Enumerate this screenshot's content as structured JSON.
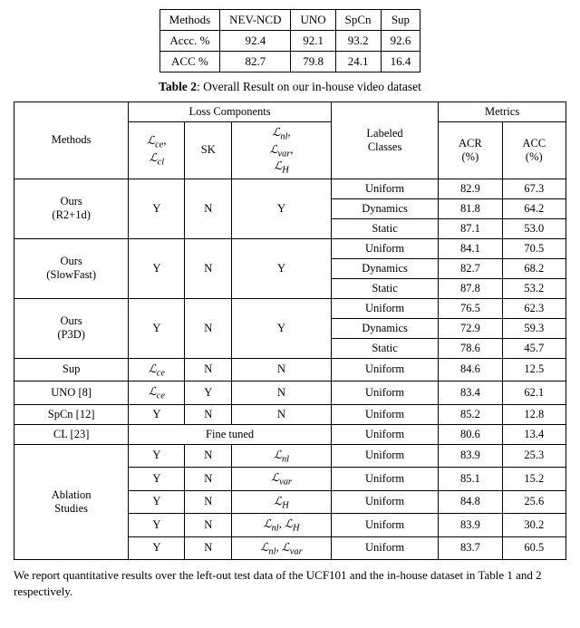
{
  "top_table": {
    "headers": [
      "Methods",
      "NEV-NCD",
      "UNO",
      "SpCn",
      "Sup"
    ],
    "rows": [
      [
        "Accc. %",
        "92.4",
        "92.1",
        "93.2",
        "92.6"
      ],
      [
        "ACC %",
        "82.7",
        "79.8",
        "24.1",
        "16.4"
      ]
    ]
  },
  "caption": {
    "label": "Table 2",
    "text": ": Overall Result on our in-house video dataset"
  },
  "main_table": {
    "col_groups": [
      {
        "label": "Loss Components",
        "colspan": 3
      },
      {
        "label": "",
        "colspan": 1
      },
      {
        "label": "Metrics",
        "colspan": 2
      }
    ],
    "sub_headers": [
      "Methods",
      "Lce, Lcl",
      "SK",
      "Lnl, Lvar, LH",
      "Labeled Classes",
      "ACR (%)",
      "ACC (%)"
    ],
    "rows": [
      {
        "method": "Ours\n(R2+1d)",
        "lce_lcl": "Y",
        "sk": "N",
        "lnl": "Y",
        "labeled": [
          "Uniform",
          "Dynamics",
          "Static"
        ],
        "acr": [
          "82.9",
          "81.8",
          "87.1"
        ],
        "acc": [
          "67.3",
          "64.2",
          "53.0"
        ]
      },
      {
        "method": "Ours\n(SlowFast)",
        "lce_lcl": "Y",
        "sk": "N",
        "lnl": "Y",
        "labeled": [
          "Uniform",
          "Dynamics",
          "Static"
        ],
        "acr": [
          "84.1",
          "82.7",
          "87.8"
        ],
        "acc": [
          "70.5",
          "68.2",
          "53.2"
        ]
      },
      {
        "method": "Ours\n(P3D)",
        "lce_lcl": "Y",
        "sk": "N",
        "lnl": "Y",
        "labeled": [
          "Uniform",
          "Dynamics",
          "Static"
        ],
        "acr": [
          "76.5",
          "72.9",
          "78.6"
        ],
        "acc": [
          "62.3",
          "59.3",
          "45.7"
        ]
      },
      {
        "method": "Sup",
        "lce_lcl": "Lce",
        "sk": "N",
        "lnl": "N",
        "labeled": [
          "Uniform"
        ],
        "acr": [
          "84.6"
        ],
        "acc": [
          "12.5"
        ]
      },
      {
        "method": "UNO [8]",
        "lce_lcl": "Lce",
        "sk": "Y",
        "lnl": "N",
        "labeled": [
          "Uniform"
        ],
        "acr": [
          "83.4"
        ],
        "acc": [
          "62.1"
        ]
      },
      {
        "method": "SpCn [12]",
        "lce_lcl": "Y",
        "sk": "N",
        "lnl": "N",
        "labeled": [
          "Uniform"
        ],
        "acr": [
          "85.2"
        ],
        "acc": [
          "12.8"
        ]
      },
      {
        "method": "CL [23]",
        "lce_lcl": "Fine tuned",
        "sk": "",
        "lnl": "",
        "labeled": [
          "Uniform"
        ],
        "acr": [
          "80.6"
        ],
        "acc": [
          "13.4"
        ],
        "finetuned": true
      },
      {
        "method": "Ablation\nStudies",
        "rows": [
          {
            "lce_lcl": "Y",
            "sk": "N",
            "lnl": "Lnl",
            "labeled": "Uniform",
            "acr": "83.9",
            "acc": "25.3"
          },
          {
            "lce_lcl": "Y",
            "sk": "N",
            "lnl": "Lvar",
            "labeled": "Uniform",
            "acr": "85.1",
            "acc": "15.2"
          },
          {
            "lce_lcl": "Y",
            "sk": "N",
            "lnl": "LH",
            "labeled": "Uniform",
            "acr": "84.8",
            "acc": "25.6"
          },
          {
            "lce_lcl": "Y",
            "sk": "N",
            "lnl": "Lnl, LH",
            "labeled": "Uniform",
            "acr": "83.9",
            "acc": "30.2"
          },
          {
            "lce_lcl": "Y",
            "sk": "N",
            "lnl": "Lnl, Lvar",
            "labeled": "Uniform",
            "acr": "83.7",
            "acc": "60.5"
          }
        ]
      }
    ]
  },
  "footer": {
    "text": "We report quantitative results over the left-out test data of the UCF101 and the in-house dataset in Table 1 and 2 respectively."
  }
}
